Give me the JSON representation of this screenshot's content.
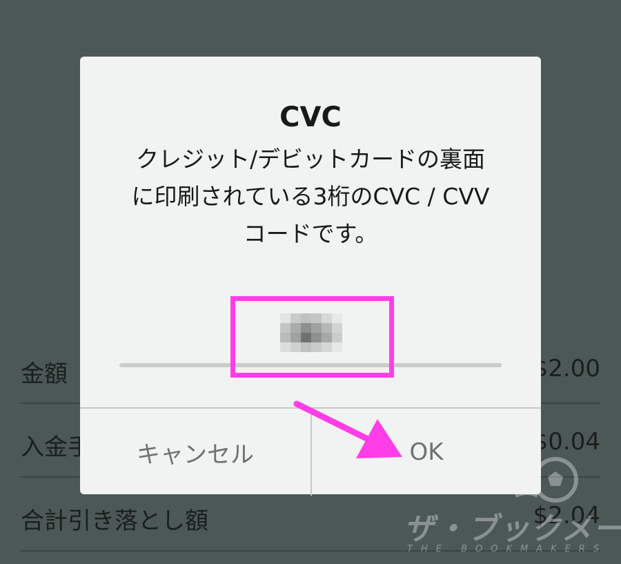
{
  "background": {
    "rows": [
      {
        "label": "金額",
        "amount": "$2.00"
      },
      {
        "label": "入金手",
        "amount": "$0.04"
      },
      {
        "label": "合計引き落とし額",
        "amount": "$2.04"
      }
    ]
  },
  "dialog": {
    "title": "CVC",
    "message_lines": [
      "クレジット/デビットカードの裏面",
      "に印刷されている3桁のCVC / CVV",
      "コードです。"
    ],
    "input": {
      "masked_value": "obscured"
    },
    "cancel_label": "キャンセル",
    "ok_label": "OK"
  },
  "watermark": {
    "title": "ザ・ブックメーカーズ",
    "subtitle": "THE BOOKMAKERS"
  },
  "colors": {
    "backdrop": "#4c5856",
    "dialog": "#f1f2f2",
    "highlight": "#ff3ee7"
  }
}
